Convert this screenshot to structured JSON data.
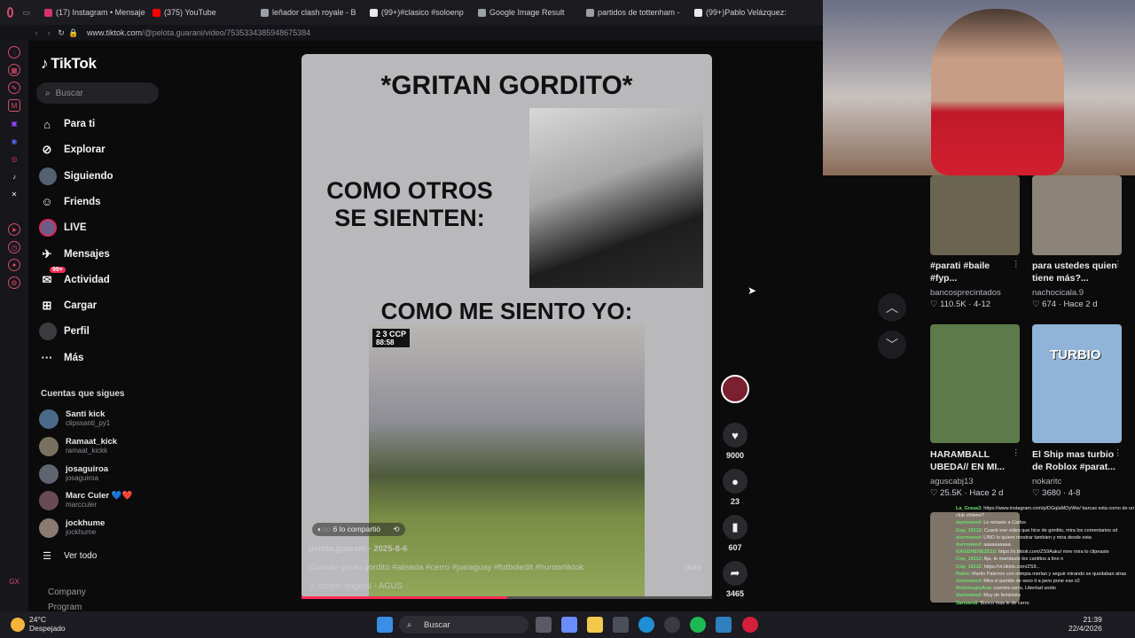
{
  "browser": {
    "tabs": [
      {
        "label": "(17) Instagram • Mensajes",
        "color": "#d6336c"
      },
      {
        "label": "(375) YouTube",
        "color": "#ff0000"
      },
      {
        "label": "leñador clash royale - B",
        "color": "#9aa0a6"
      },
      {
        "label": "(99+)#clasico #soloenp",
        "color": "#e8e8e8"
      },
      {
        "label": "Google Image Result",
        "color": "#9aa0a6"
      },
      {
        "label": "partidos de tottenham -",
        "color": "#9aa0a6"
      },
      {
        "label": "(99+)Pablo Velázquez:",
        "color": "#e8e8e8"
      }
    ],
    "url_prefix": "www.tiktok.com",
    "url_path": "/@pelota.guarani/video/7535334385948675384"
  },
  "tiktok": {
    "logo": "TikTok",
    "search_placeholder": "Buscar",
    "nav": [
      {
        "label": "Para ti",
        "icon": "home-icon"
      },
      {
        "label": "Explorar",
        "icon": "compass-icon"
      },
      {
        "label": "Siguiendo",
        "icon": "following-avatar"
      },
      {
        "label": "Friends",
        "icon": "friends-icon"
      },
      {
        "label": "LIVE",
        "icon": "live-avatar"
      },
      {
        "label": "Mensajes",
        "icon": "messages-icon"
      },
      {
        "label": "Actividad",
        "icon": "activity-icon",
        "badge": "99+"
      },
      {
        "label": "Cargar",
        "icon": "upload-icon"
      },
      {
        "label": "Perfil",
        "icon": "profile-avatar"
      },
      {
        "label": "Más",
        "icon": "more-icon"
      }
    ],
    "following_header": "Cuentas que sigues",
    "accounts": [
      {
        "name": "Santi kick",
        "handle": "clipssanti_py1",
        "color": "#4b6a8a"
      },
      {
        "name": "Ramaat_kick",
        "handle": "ramaat_kickk",
        "color": "#7a7060"
      },
      {
        "name": "josaguiroa",
        "handle": "josaguiroa",
        "color": "#5e6470"
      },
      {
        "name": "Marc Culer 💙❤️",
        "handle": "marcculer",
        "color": "#6a4a55"
      },
      {
        "name": "jockhume",
        "handle": "jockhume",
        "color": "#8a7a70"
      }
    ],
    "see_all": "Ver todo",
    "footer": [
      "Company",
      "Program"
    ]
  },
  "video": {
    "top_caption": "*GRITAN GORDITO*",
    "left_caption_1": "COMO OTROS",
    "left_caption_2": "SE SIENTEN:",
    "mid_caption": "COMO ME SIENTO YO:",
    "scoreboard": "2 3 CCP",
    "match_time": "88:58",
    "shared_text": "6 lo compartió",
    "author_line": "pelota.guarani · 2025-8-6",
    "description": "Cuando gritan gordito #aliseda #cerro #paraguay #futboledit #humortiktok",
    "more": "más",
    "sound": "sonido original - AGUS",
    "progress": 0.5
  },
  "actions": {
    "likes": "9000",
    "comments": "23",
    "saves": "607",
    "shares": "3465"
  },
  "grid": [
    {
      "title": "#parati #baile #fyp...",
      "user": "bancosprecintados",
      "stats": "110.5K · 4-12",
      "color": "#6b6450"
    },
    {
      "title": "para ustedes quien tiene más?...",
      "user": "nachocicala.9",
      "stats": "674 · Hace 2 d",
      "color": "#8c8478"
    },
    {
      "title": "HARAMBALL UBEDA// EN MI...",
      "user": "aguscabj13",
      "stats": "25.5K · Hace 2 d",
      "color": "#5d7a4a"
    },
    {
      "title": "El Ship mas turbio de Roblox #parat...",
      "user": "nokaritc",
      "stats": "3680 · 4-8",
      "color": "#8fb4d8"
    }
  ],
  "grid_overlay_text": "TURBIO",
  "chat": [
    {
      "user": "La_Grasa3",
      "text": "https://www.instagram.com/p/DGqlaMOyWw/ barcas esta como de un club chileno?"
    },
    {
      "user": "durrnweed",
      "text": "Le miraste a Carlos"
    },
    {
      "user": "Cop_19112",
      "text": "Cuanti ese video que hice de gordito, mira los comentarios xd"
    },
    {
      "user": "durrnweed",
      "text": "LINO lo quiere mostrar tambien y mira desde esta"
    },
    {
      "user": "durrnweed",
      "text": "aaaaaaaaaa"
    },
    {
      "user": "GAGDHENEZE15",
      "text": "https://x.tiktok.com/ZS9Aaku/ mire mira lo clipeaste"
    },
    {
      "user": "Cop_19112",
      "text": "Aja, te mandaste los cantitos a lino o"
    },
    {
      "user": "Cop_19112",
      "text": "https://vt.tiktok.com/ZS9..."
    },
    {
      "user": "Pablo",
      "text": "Martin Palermo con olimpia merlan y seguir mirando se quedaban atras"
    },
    {
      "user": "durrnweed",
      "text": "Mira el partido de sexo it a pero pone ese x2"
    },
    {
      "user": "RobotsupoAna",
      "text": "cuentra cerro, Libertad unido"
    },
    {
      "user": "durrnweed",
      "text": "Muy de feminista"
    },
    {
      "user": "Sansandi",
      "text": "Bonco mas le de cerro"
    }
  ],
  "taskbar": {
    "temp": "24°C",
    "weather": "Despejado",
    "search": "Buscar",
    "time": "21:39",
    "date": "22/4/2026"
  }
}
